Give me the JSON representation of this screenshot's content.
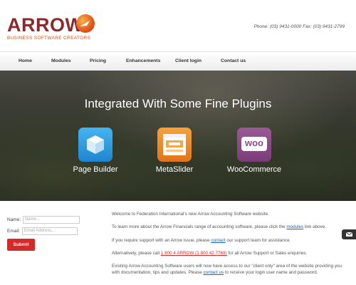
{
  "header": {
    "logo_word": "ARROW",
    "logo_tagline": "BUSINESS SOFTWARE CREATORS",
    "contact": "Phone: (03) 9431-0000  Fax: (03) 9431-2799"
  },
  "nav": {
    "items": [
      "Home",
      "Modules",
      "Pricing",
      "Enhancements",
      "Client login",
      "Contact us"
    ]
  },
  "hero": {
    "title": "Integrated With Some Fine Plugins",
    "plugins": [
      {
        "label": "Page Builder",
        "icon": "cube-icon",
        "color": "#2a9be0"
      },
      {
        "label": "MetaSlider",
        "icon": "slider-icon",
        "color": "#f08a1c"
      },
      {
        "label": "WooCommerce",
        "icon": "woo-icon",
        "color": "#8a4a86",
        "icon_text": "woo"
      }
    ]
  },
  "form": {
    "name_label": "Name:",
    "name_placeholder": "Name...",
    "email_label": "Email:",
    "email_placeholder": "Email Address...",
    "submit_label": "Submit"
  },
  "content": {
    "p1": "Welcome to Federation International's new Arrow Accounting Software website.",
    "p2_before": "To learn more about the Arrow Financials range of accounting software, please click the ",
    "p2_link": "modules",
    "p2_after": " link above.",
    "p3_before": "If you require support with an Arrow issue, please ",
    "p3_link": "contact",
    "p3_after": " our support team for assistance.",
    "p4_before": "Alternatively, please call ",
    "p4_link": "1 800 4 ARROW (1 800 42 7769)",
    "p4_after": " for all Arrow Support or Sales enquiries.",
    "p5_before": "Existing Arrow Accounting Software users will now have access to our \"client only\" area of the website providing you with documentation, tips and updates. Please ",
    "p5_link": "contact us",
    "p5_after": " to receive your login user name and password."
  },
  "colors": {
    "accent": "#d42a2a",
    "brand": "#8b2a2a",
    "link": "#1a5fb4"
  },
  "side_tab": {
    "icon": "mail-icon"
  }
}
